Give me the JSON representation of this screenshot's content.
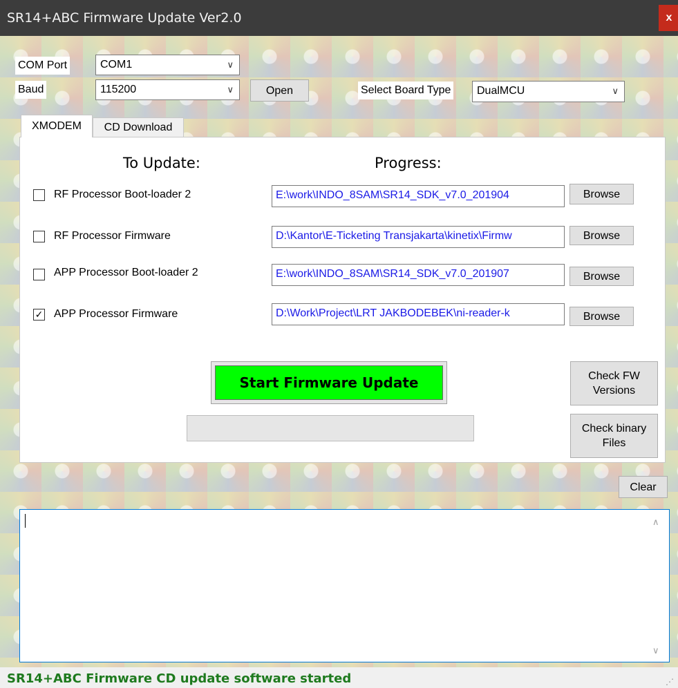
{
  "window": {
    "title": "SR14+ABC Firmware Update Ver2.0",
    "close_glyph": "x"
  },
  "connection": {
    "com_port_label": "COM Port",
    "com_port_value": "COM1",
    "baud_label": "Baud",
    "baud_value": "115200",
    "open_label": "Open",
    "board_type_label": "Select Board Type",
    "board_type_value": "DualMCU"
  },
  "tabs": [
    {
      "label": "XMODEM",
      "active": true
    },
    {
      "label": "CD Download",
      "active": false
    }
  ],
  "panel": {
    "to_update_heading": "To Update:",
    "progress_heading": "Progress:",
    "items": [
      {
        "label": "RF Processor Boot-loader 2",
        "checked": false,
        "path": "E:\\work\\INDO_8SAM\\SR14_SDK_v7.0_201904",
        "browse_label": "Browse"
      },
      {
        "label": "RF Processor Firmware",
        "checked": false,
        "path": "D:\\Kantor\\E-Ticketing Transjakarta\\kinetix\\Firmw",
        "browse_label": "Browse"
      },
      {
        "label": "APP Processor Boot-loader 2",
        "checked": false,
        "path": "E:\\work\\INDO_8SAM\\SR14_SDK_v7.0_201907",
        "browse_label": "Browse"
      },
      {
        "label": "APP Processor Firmware",
        "checked": true,
        "path": "D:\\Work\\Project\\LRT JAKBODEBEK\\ni-reader-k",
        "browse_label": "Browse"
      }
    ],
    "start_label": "Start Firmware Update",
    "check_fw_label": "Check FW Versions",
    "check_binary_label": "Check binary Files",
    "progress_value": 0
  },
  "log": {
    "clear_label": "Clear",
    "text": ""
  },
  "status": {
    "text": "SR14+ABC Firmware CD update software started"
  },
  "icons": {
    "chevron": "chevron-down-icon",
    "check": "checkmark-icon",
    "scroll_up": "scroll-up-icon",
    "scroll_down": "scroll-down-icon",
    "grip": "resize-grip-icon"
  },
  "colors": {
    "start_button": "#00ff00",
    "path_text": "#1a1ae6",
    "status_text": "#1e7a1e",
    "close_button": "#c42b1c",
    "log_focus_border": "#0078d7"
  }
}
